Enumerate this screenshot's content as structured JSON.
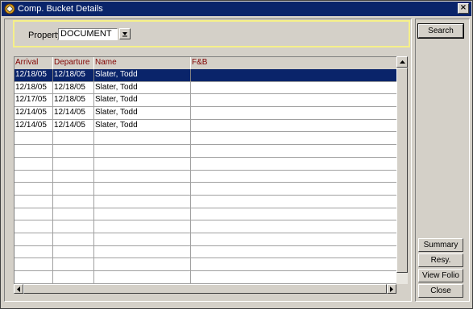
{
  "window": {
    "title": "Comp. Bucket Details",
    "close_symbol": "×"
  },
  "filter": {
    "property_label": "Property",
    "property_value": "DOCUMENT"
  },
  "grid": {
    "columns": [
      "Arrival",
      "Departure",
      "Name",
      "F&B"
    ],
    "rows": [
      {
        "arrival": "12/18/05",
        "departure": "12/18/05",
        "name": "Slater, Todd",
        "fb": "",
        "selected": true
      },
      {
        "arrival": "12/18/05",
        "departure": "12/18/05",
        "name": "Slater, Todd",
        "fb": ""
      },
      {
        "arrival": "12/17/05",
        "departure": "12/18/05",
        "name": "Slater, Todd",
        "fb": ""
      },
      {
        "arrival": "12/14/05",
        "departure": "12/14/05",
        "name": "Slater, Todd",
        "fb": ""
      },
      {
        "arrival": "12/14/05",
        "departure": "12/14/05",
        "name": "Slater, Todd",
        "fb": ""
      }
    ],
    "empty_row_count": 12
  },
  "buttons": {
    "search": "Search",
    "summary": "Summary",
    "resy": "Resy.",
    "view_folio": "View Folio",
    "close": "Close"
  },
  "colors": {
    "title_bar": "#0a246a",
    "selection": "#0a246a",
    "header_text": "#800000",
    "filter_border": "#f6f089"
  }
}
